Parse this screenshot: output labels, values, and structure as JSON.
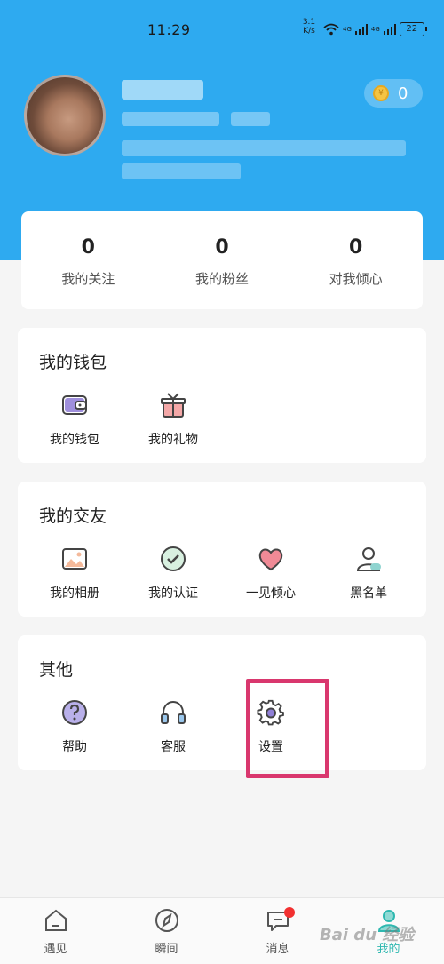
{
  "status_bar": {
    "time": "11:29",
    "speed_value": "3.1",
    "speed_unit": "K/s",
    "network_1": "4G",
    "network_2": "4G",
    "battery": "22"
  },
  "profile": {
    "coins": "0"
  },
  "stats": [
    {
      "value": "0",
      "label": "我的关注"
    },
    {
      "value": "0",
      "label": "我的粉丝"
    },
    {
      "value": "0",
      "label": "对我倾心"
    }
  ],
  "wallet": {
    "title": "我的钱包",
    "items": [
      {
        "label": "我的钱包",
        "icon": "wallet-icon"
      },
      {
        "label": "我的礼物",
        "icon": "gift-icon"
      }
    ]
  },
  "friends": {
    "title": "我的交友",
    "items": [
      {
        "label": "我的相册",
        "icon": "album-icon"
      },
      {
        "label": "我的认证",
        "icon": "verified-icon"
      },
      {
        "label": "一见倾心",
        "icon": "heart-icon"
      },
      {
        "label": "黑名单",
        "icon": "blacklist-icon"
      }
    ]
  },
  "other": {
    "title": "其他",
    "items": [
      {
        "label": "帮助",
        "icon": "help-icon"
      },
      {
        "label": "客服",
        "icon": "headset-icon"
      },
      {
        "label": "设置",
        "icon": "gear-icon"
      }
    ]
  },
  "tabbar": {
    "items": [
      {
        "label": "遇见",
        "icon": "home-icon"
      },
      {
        "label": "瞬间",
        "icon": "compass-icon"
      },
      {
        "label": "消息",
        "icon": "chat-icon"
      },
      {
        "label": "我的",
        "icon": "profile-icon"
      }
    ]
  },
  "watermark": "Bai du 经验",
  "colors": {
    "header": "#2eaaf0",
    "accent": "#2eb8b0",
    "highlight": "#d9376e",
    "badge": "#f23030"
  }
}
